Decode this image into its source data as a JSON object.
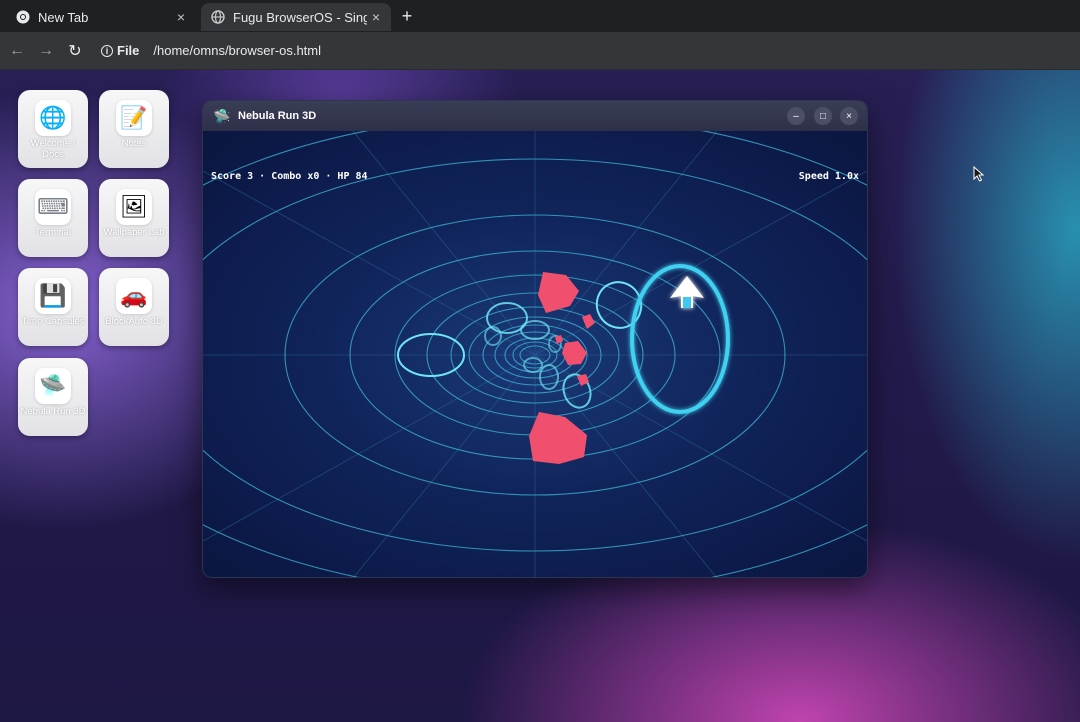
{
  "tabs": [
    {
      "title": "New Tab",
      "close": "×"
    },
    {
      "title": "Fugu BrowserOS - Single",
      "close": "×"
    }
  ],
  "new_tab_label": "+",
  "toolbar": {
    "back": "←",
    "forward": "→",
    "reload": "↻",
    "scheme": "File",
    "url": "/home/omns/browser-os.html"
  },
  "desktop_icons": [
    {
      "label": "Welcome / Docs",
      "icon": "globe-icon",
      "glyph": "🌐"
    },
    {
      "label": "Notes",
      "icon": "notepad-icon",
      "glyph": "📝"
    },
    {
      "label": "Terminal",
      "icon": "keyboard-icon",
      "glyph": "⌨"
    },
    {
      "label": "Wallpaper Lab",
      "icon": "picture-icon",
      "glyph": "🖼"
    },
    {
      "label": "Time Capsules",
      "icon": "floppy-disk-icon",
      "glyph": "💾"
    },
    {
      "label": "BlockAuto 3D",
      "icon": "car-icon",
      "glyph": "🚗"
    },
    {
      "label": "Nebula Run 3D",
      "icon": "ufo-icon",
      "glyph": "🛸"
    }
  ],
  "window": {
    "title": "Nebula Run 3D",
    "minimize": "–",
    "maximize": "□",
    "close": "×"
  },
  "game": {
    "hud_left": "Score 3 · Combo x0 · HP 84",
    "hud_right": "Speed 1.0x",
    "colors": {
      "ring": "#3fb8d8",
      "active_ring": "#3fd0f0",
      "obstacle": "#f0506e",
      "ship": "#ffffff"
    }
  }
}
